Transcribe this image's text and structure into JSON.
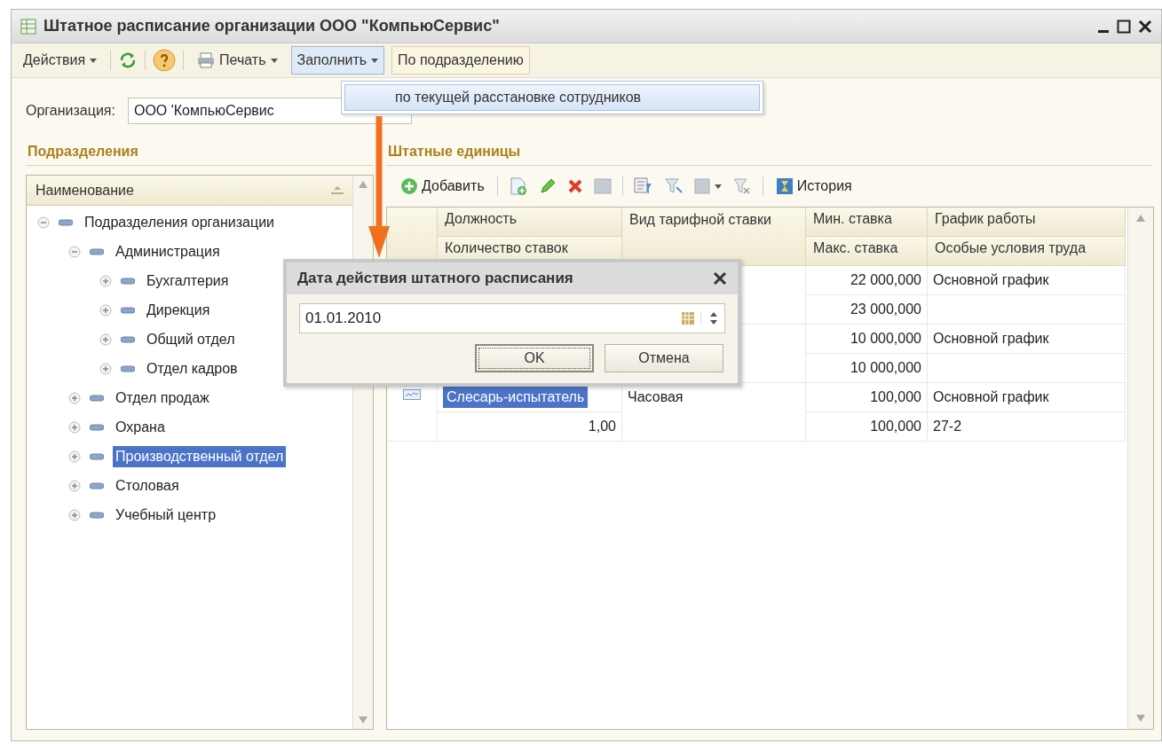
{
  "window": {
    "title": "Штатное расписание организации ООО \"КомпьюСервис\""
  },
  "toolbar": [
    {
      "label": "Действия",
      "kind": "menu",
      "pressed": false
    },
    {
      "label": "Печать",
      "kind": "menu",
      "pressed": false
    },
    {
      "label": "Заполнить",
      "kind": "menu",
      "pressed": true
    },
    {
      "label": "По подразделению",
      "kind": "button",
      "pressed": false
    }
  ],
  "fill_menu": {
    "items": [
      "по текущей расстановке сотрудников"
    ]
  },
  "organization": {
    "label": "Организация:",
    "value": "ООО 'КомпьюСервис"
  },
  "departments": {
    "title": "Подразделения",
    "column": "Наименование",
    "tree": [
      {
        "label": "Подразделения организации",
        "expanded": true,
        "selected": false,
        "children": [
          {
            "label": "Администрация",
            "expanded": true,
            "selected": false,
            "children": [
              {
                "label": "Бухгалтерия",
                "expanded": false,
                "selected": false
              },
              {
                "label": "Дирекция",
                "expanded": false,
                "selected": false
              },
              {
                "label": "Общий отдел",
                "expanded": false,
                "selected": false
              },
              {
                "label": "Отдел кадров",
                "expanded": false,
                "selected": false
              }
            ]
          },
          {
            "label": "Отдел продаж",
            "expanded": false,
            "selected": false
          },
          {
            "label": "Охрана",
            "expanded": false,
            "selected": false
          },
          {
            "label": "Производственный отдел",
            "expanded": false,
            "selected": true
          },
          {
            "label": "Столовая",
            "expanded": false,
            "selected": false
          },
          {
            "label": "Учебный центр",
            "expanded": false,
            "selected": false
          }
        ]
      }
    ]
  },
  "staff_units": {
    "title": "Штатные единицы",
    "add_label": "Добавить",
    "history_label": "История",
    "columns": [
      {
        "top": "Должность",
        "bottom": "Количество ставок"
      },
      {
        "top": "Вид тарифной ставки"
      },
      {
        "top": "Мин. ставка",
        "bottom": "Макс. ставка"
      },
      {
        "top": "График работы",
        "bottom": "Особые условия труда"
      }
    ],
    "rows": [
      {
        "min_rate": "22 000,000",
        "schedule": "Основной график",
        "max_rate": "23 000,000"
      },
      {
        "min_rate": "10 000,000",
        "schedule": "Основной график",
        "max_rate": "10 000,000"
      },
      {
        "selected": true,
        "position": "Слесарь-испытатель",
        "rate_type": "Часовая",
        "min_rate": "100,000",
        "schedule": "Основной график",
        "count": "1,00",
        "max_rate": "100,000",
        "conditions": "27-2"
      }
    ]
  },
  "dialog": {
    "title": "Дата действия штатного расписания",
    "date": "01.01.2010",
    "buttons": [
      {
        "label": "OK",
        "default": true
      },
      {
        "label": "Отмена",
        "default": false
      }
    ]
  }
}
